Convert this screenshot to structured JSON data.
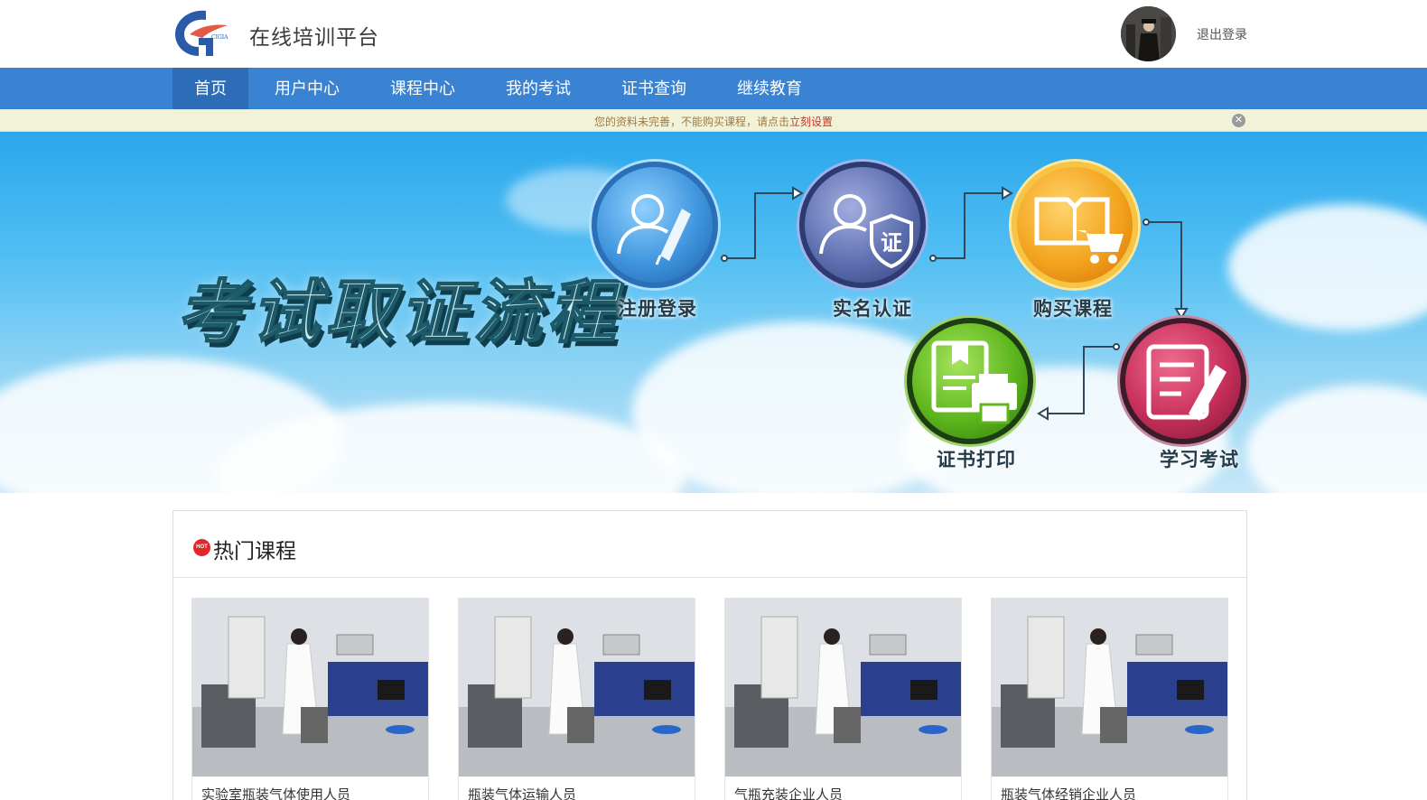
{
  "header": {
    "site_title": "在线培训平台",
    "logout_label": "退出登录",
    "logo_text": "CIGIA"
  },
  "nav": {
    "items": [
      "首页",
      "用户中心",
      "课程中心",
      "我的考试",
      "证书查询",
      "继续教育"
    ],
    "active_index": 0
  },
  "notice": {
    "text": "您的资料未完善，不能购买课程，请点击",
    "link_label": "立刻设置",
    "close_symbol": "✕"
  },
  "banner": {
    "title": "考试取证流程",
    "steps": [
      {
        "label": "注册登录",
        "icon": "user-pen-icon",
        "color": "#4a9fe0"
      },
      {
        "label": "实名认证",
        "icon": "user-shield-icon",
        "color": "#5d6fb0"
      },
      {
        "label": "购买课程",
        "icon": "book-cart-icon",
        "color": "#f3a41e"
      },
      {
        "label": "学习考试",
        "icon": "document-pen-icon",
        "color": "#c62f5a"
      },
      {
        "label": "证书打印",
        "icon": "certificate-printer-icon",
        "color": "#5db61d"
      }
    ],
    "shield_char": "证"
  },
  "hot": {
    "badge": "HOT",
    "title": "热门课程",
    "courses": [
      {
        "title": "实验室瓶装气体使用人员"
      },
      {
        "title": "瓶装气体运输人员"
      },
      {
        "title": "气瓶充装企业人员"
      },
      {
        "title": "瓶装气体经销企业人员"
      }
    ]
  },
  "colors": {
    "nav": "#3a83d3",
    "nav_active": "#2d6db8",
    "notice_bg": "#f2f2d8",
    "link": "#c0392b"
  }
}
